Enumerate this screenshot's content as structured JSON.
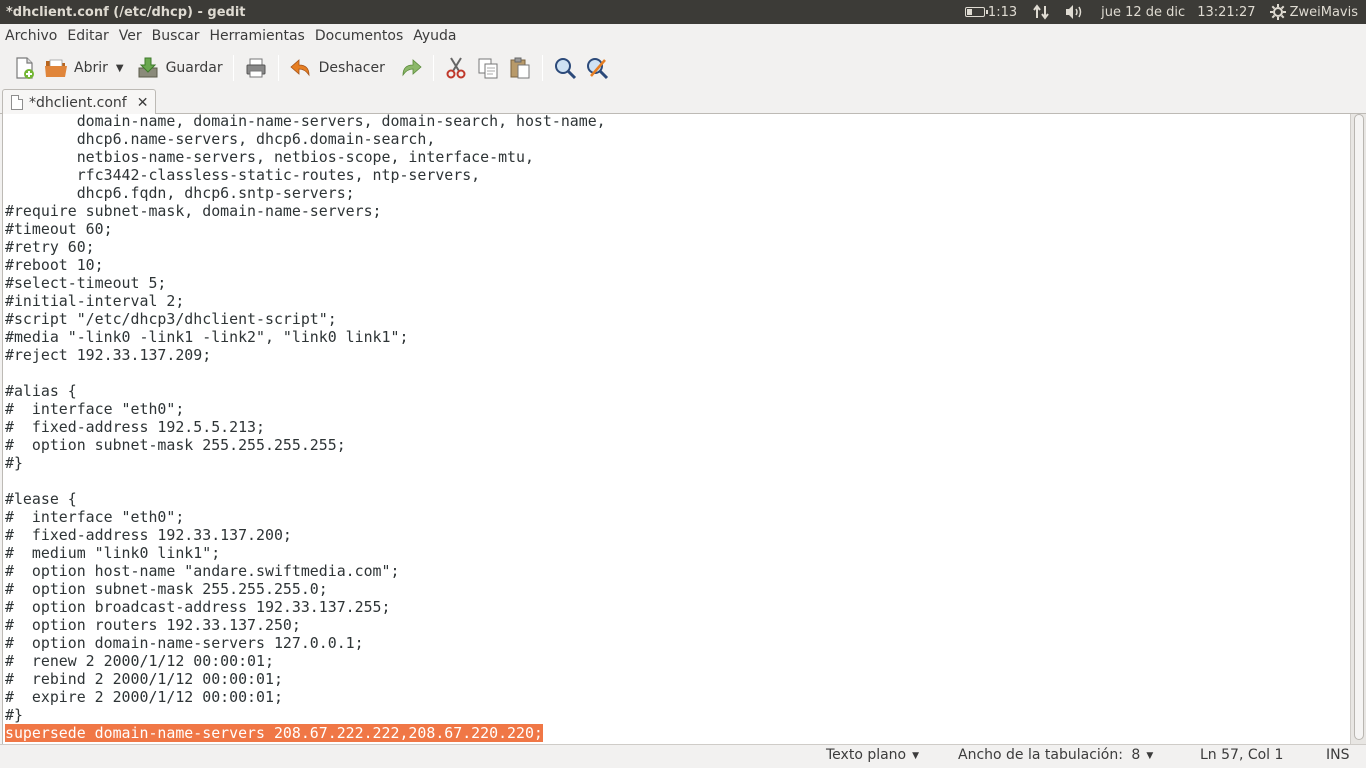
{
  "top_panel": {
    "window_title": "*dhclient.conf (/etc/dhcp) - gedit",
    "battery": "1:13",
    "network_icon": "network-updown-icon",
    "volume_icon": "volume-icon",
    "date": "jue 12 de dic",
    "time": "13:21:27",
    "user": "ZweiMavis"
  },
  "menubar": {
    "items": [
      "Archivo",
      "Editar",
      "Ver",
      "Buscar",
      "Herramientas",
      "Documentos",
      "Ayuda"
    ]
  },
  "toolbar": {
    "open_label": "Abrir",
    "save_label": "Guardar",
    "undo_label": "Deshacer"
  },
  "tab": {
    "label": "*dhclient.conf",
    "close": "✕"
  },
  "editor": {
    "lines": [
      "        domain-name, domain-name-servers, domain-search, host-name,",
      "        dhcp6.name-servers, dhcp6.domain-search,",
      "        netbios-name-servers, netbios-scope, interface-mtu,",
      "        rfc3442-classless-static-routes, ntp-servers,",
      "        dhcp6.fqdn, dhcp6.sntp-servers;",
      "#require subnet-mask, domain-name-servers;",
      "#timeout 60;",
      "#retry 60;",
      "#reboot 10;",
      "#select-timeout 5;",
      "#initial-interval 2;",
      "#script \"/etc/dhcp3/dhclient-script\";",
      "#media \"-link0 -link1 -link2\", \"link0 link1\";",
      "#reject 192.33.137.209;",
      "",
      "#alias {",
      "#  interface \"eth0\";",
      "#  fixed-address 192.5.5.213;",
      "#  option subnet-mask 255.255.255.255;",
      "#}",
      "",
      "#lease {",
      "#  interface \"eth0\";",
      "#  fixed-address 192.33.137.200;",
      "#  medium \"link0 link1\";",
      "#  option host-name \"andare.swiftmedia.com\";",
      "#  option subnet-mask 255.255.255.0;",
      "#  option broadcast-address 192.33.137.255;",
      "#  option routers 192.33.137.250;",
      "#  option domain-name-servers 127.0.0.1;",
      "#  renew 2 2000/1/12 00:00:01;",
      "#  rebind 2 2000/1/12 00:00:01;",
      "#  expire 2 2000/1/12 00:00:01;",
      "#}"
    ],
    "selected_line": "supersede domain-name-servers 208.67.222.222,208.67.220.220;"
  },
  "statusbar": {
    "language": "Texto plano",
    "tab_width_label": "Ancho de la tabulación:",
    "tab_width_value": "8",
    "position": "Ln 57, Col 1",
    "mode": "INS"
  },
  "colors": {
    "selection": "#f07746",
    "panel": "#3c3b37"
  }
}
